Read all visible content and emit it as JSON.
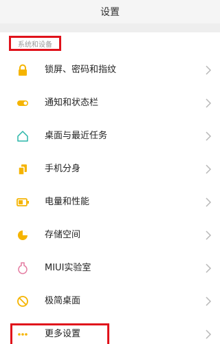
{
  "header": {
    "title": "设置"
  },
  "section": {
    "label": "系统和设备"
  },
  "items": [
    {
      "label": "锁屏、密码和指纹",
      "icon": "lock-icon"
    },
    {
      "label": "通知和状态栏",
      "icon": "toggle-icon"
    },
    {
      "label": "桌面与最近任务",
      "icon": "home-icon"
    },
    {
      "label": "手机分身",
      "icon": "clone-icon"
    },
    {
      "label": "电量和性能",
      "icon": "battery-icon"
    },
    {
      "label": "存储空间",
      "icon": "storage-pie-icon"
    },
    {
      "label": "MIUI实验室",
      "icon": "flask-icon"
    },
    {
      "label": "极简桌面",
      "icon": "minimal-desktop-icon"
    },
    {
      "label": "更多设置",
      "icon": "more-dots-icon"
    }
  ],
  "colors": {
    "accent": "#f5b400",
    "highlight": "#e0121b",
    "teal": "#29b6a8",
    "pink": "#e47aa0"
  }
}
